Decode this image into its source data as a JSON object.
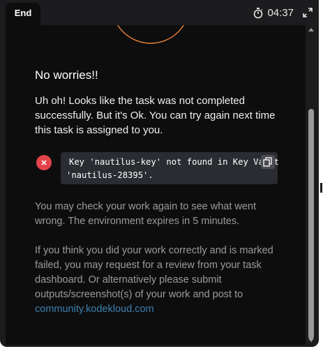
{
  "header": {
    "end_label": "End",
    "timer": "04:37"
  },
  "main": {
    "title": "No worries!!",
    "message": "Uh oh! Looks like the task was not completed successfully. But it's Ok. You can try again next time this task is assigned to you.",
    "error": {
      "line1": "Key 'nautilus-key' not found in Key Vault",
      "line2": "'nautilus-28395'."
    },
    "note_check": "You may check your work again to see what went wrong. The environment expires in 5 minutes.",
    "note_review": "If you think you did your work correctly and is marked failed, you may request for a review from your task dashboard. Or alternatively please submit outputs/screenshot(s) of your work and post to ",
    "community_link": "community.kodekloud.com"
  },
  "colors": {
    "panel_bg": "#1c1c1e",
    "content_bg": "#0d0d0e",
    "error_red": "#e3434a",
    "arc_orange": "#e8813a",
    "link_blue": "#3d7fae"
  },
  "icons": [
    "stopwatch-icon",
    "expand-icon",
    "close-x-icon",
    "copy-icon"
  ]
}
